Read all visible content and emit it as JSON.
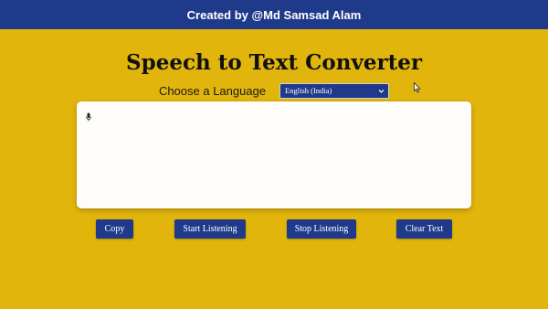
{
  "header": {
    "credit": "Created by @Md Samsad Alam",
    "background_color": "#1f3a8a"
  },
  "page": {
    "title": "Speech to Text Converter",
    "background_color": "#e2b50c"
  },
  "language": {
    "label": "Choose a Language",
    "selected": "English (India)"
  },
  "transcript": {
    "text": "",
    "icon": "microphone-icon"
  },
  "buttons": {
    "copy": "Copy",
    "start": "Start Listening",
    "stop": "Stop Listening",
    "clear": "Clear Text"
  }
}
